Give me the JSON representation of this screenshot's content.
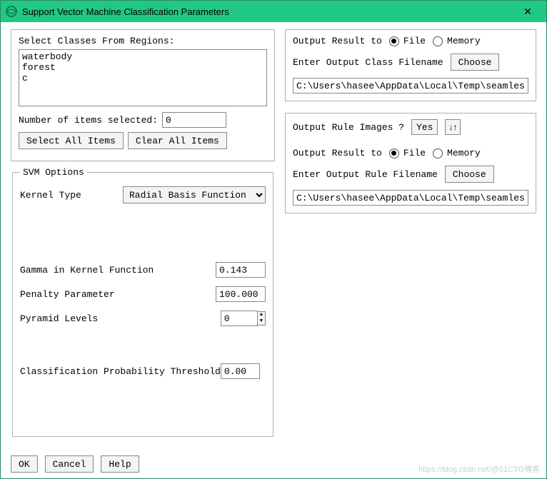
{
  "window": {
    "title": "Support Vector Machine Classification Parameters",
    "close_glyph": "✕"
  },
  "classes": {
    "label": "Select Classes From Regions:",
    "items": [
      "waterbody",
      "forest",
      "c"
    ],
    "num_selected_label": "Number of items selected:",
    "num_selected_value": "0",
    "select_all": "Select All Items",
    "clear_all": "Clear All Items"
  },
  "svm": {
    "legend": "SVM Options",
    "kernel_label": "Kernel Type",
    "kernel_value": "Radial Basis Function",
    "gamma_label": "Gamma in Kernel Function",
    "gamma_value": "0.143",
    "penalty_label": "Penalty Parameter",
    "penalty_value": "100.000",
    "pyramid_label": "Pyramid Levels",
    "pyramid_value": "0",
    "threshold_label": "Classification Probability Threshold",
    "threshold_value": "0.00"
  },
  "output_class": {
    "result_label": "Output Result to",
    "file": "File",
    "memory": "Memory",
    "selected": "file",
    "filename_label": "Enter Output Class Filename",
    "choose": "Choose",
    "filename_value": "C:\\Users\\hasee\\AppData\\Local\\Temp\\seamles"
  },
  "output_rule": {
    "question": "Output Rule Images ?",
    "yes": "Yes",
    "swap_glyph": "↓↑",
    "result_label": "Output Result to",
    "file": "File",
    "memory": "Memory",
    "selected": "file",
    "filename_label": "Enter Output Rule Filename",
    "choose": "Choose",
    "filename_value": "C:\\Users\\hasee\\AppData\\Local\\Temp\\seamles"
  },
  "footer": {
    "ok": "OK",
    "cancel": "Cancel",
    "help": "Help"
  },
  "watermark": "https://blog.csdn.net/@51CTO博客"
}
